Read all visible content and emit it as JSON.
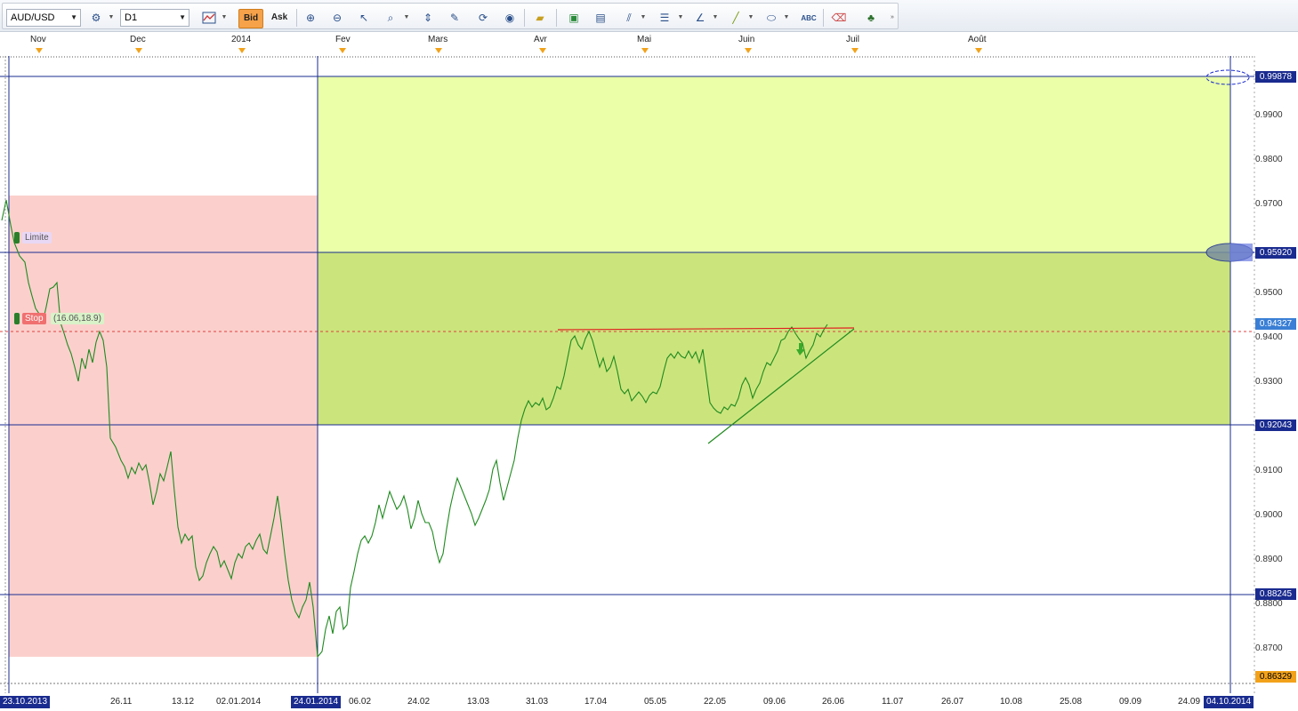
{
  "toolbar": {
    "symbol": "AUD/USD",
    "timeframe": "D1",
    "bid_label": "Bid",
    "ask_label": "Ask",
    "icons": [
      "chart-settings-icon",
      "zoom-in-icon",
      "zoom-out-icon",
      "cursor-icon",
      "zoom-box-icon",
      "autoscroll-icon",
      "edit-icon",
      "sync-icon",
      "globe-icon",
      "ruler-icon",
      "image-icon",
      "template-icon",
      "fibonacci-icon",
      "levels-icon",
      "channel-icon",
      "line-icon",
      "ellipse-icon",
      "text-icon",
      "eraser-icon",
      "objects-icon"
    ]
  },
  "months": [
    "Nov",
    "Dec",
    "2014",
    "Fev",
    "Mars",
    "Avr",
    "Mai",
    "Juin",
    "Juil",
    "Août"
  ],
  "price_axis": [
    "0.9900",
    "0.9800",
    "0.9700",
    "0.9500",
    "0.9400",
    "0.9300",
    "0.9100",
    "0.9000",
    "0.8900",
    "0.8800",
    "0.8700"
  ],
  "price_boxes": {
    "top": "0.99878",
    "mid_upper": "0.95920",
    "current": "0.94327",
    "mid_lower": "0.92043",
    "low_line": "0.88245",
    "bottom": "0.86329"
  },
  "tags": {
    "limit": "Limite",
    "stop": "Stop",
    "stop_values": "(16.06,18.9)"
  },
  "dates": {
    "start": "23.10.2013",
    "marked": "24.01.2014",
    "end": "04.10.2014",
    "ticks": [
      "26.11",
      "13.12",
      "02.01.2014",
      "06.02",
      "24.02",
      "13.03",
      "31.03",
      "17.04",
      "05.05",
      "22.05",
      "09.06",
      "26.06",
      "11.07",
      "26.07",
      "10.08",
      "25.08",
      "09.09",
      "24.09"
    ]
  },
  "colors": {
    "price_line": "#1f8a1f",
    "loss_zone": "#fbd0cc",
    "profit_zone_light": "#eaffa8",
    "profit_zone_dark": "#cbe57c",
    "levels": "#1a2b8f",
    "accent": "#f6a24a"
  }
}
